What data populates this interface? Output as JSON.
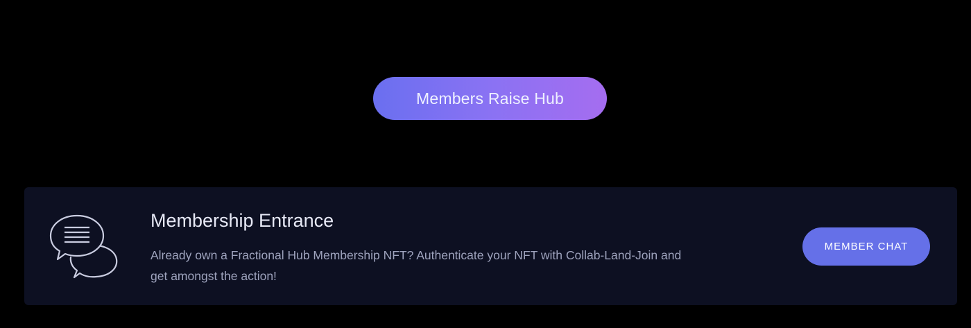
{
  "hub_button": {
    "label": "Members Raise Hub"
  },
  "membership_card": {
    "icon": "chat-bubbles-icon",
    "title": "Membership Entrance",
    "description": "Already own a Fractional Hub Membership NFT? Authenticate your NFT with Collab-Land-Join and get amongst the action!",
    "button_label": "MEMBER CHAT"
  },
  "colors": {
    "background": "#000000",
    "card_background": "#0d1022",
    "hub_gradient_start": "#6a6ff0",
    "hub_gradient_end": "#a56df0",
    "chat_button": "#6570e8"
  }
}
